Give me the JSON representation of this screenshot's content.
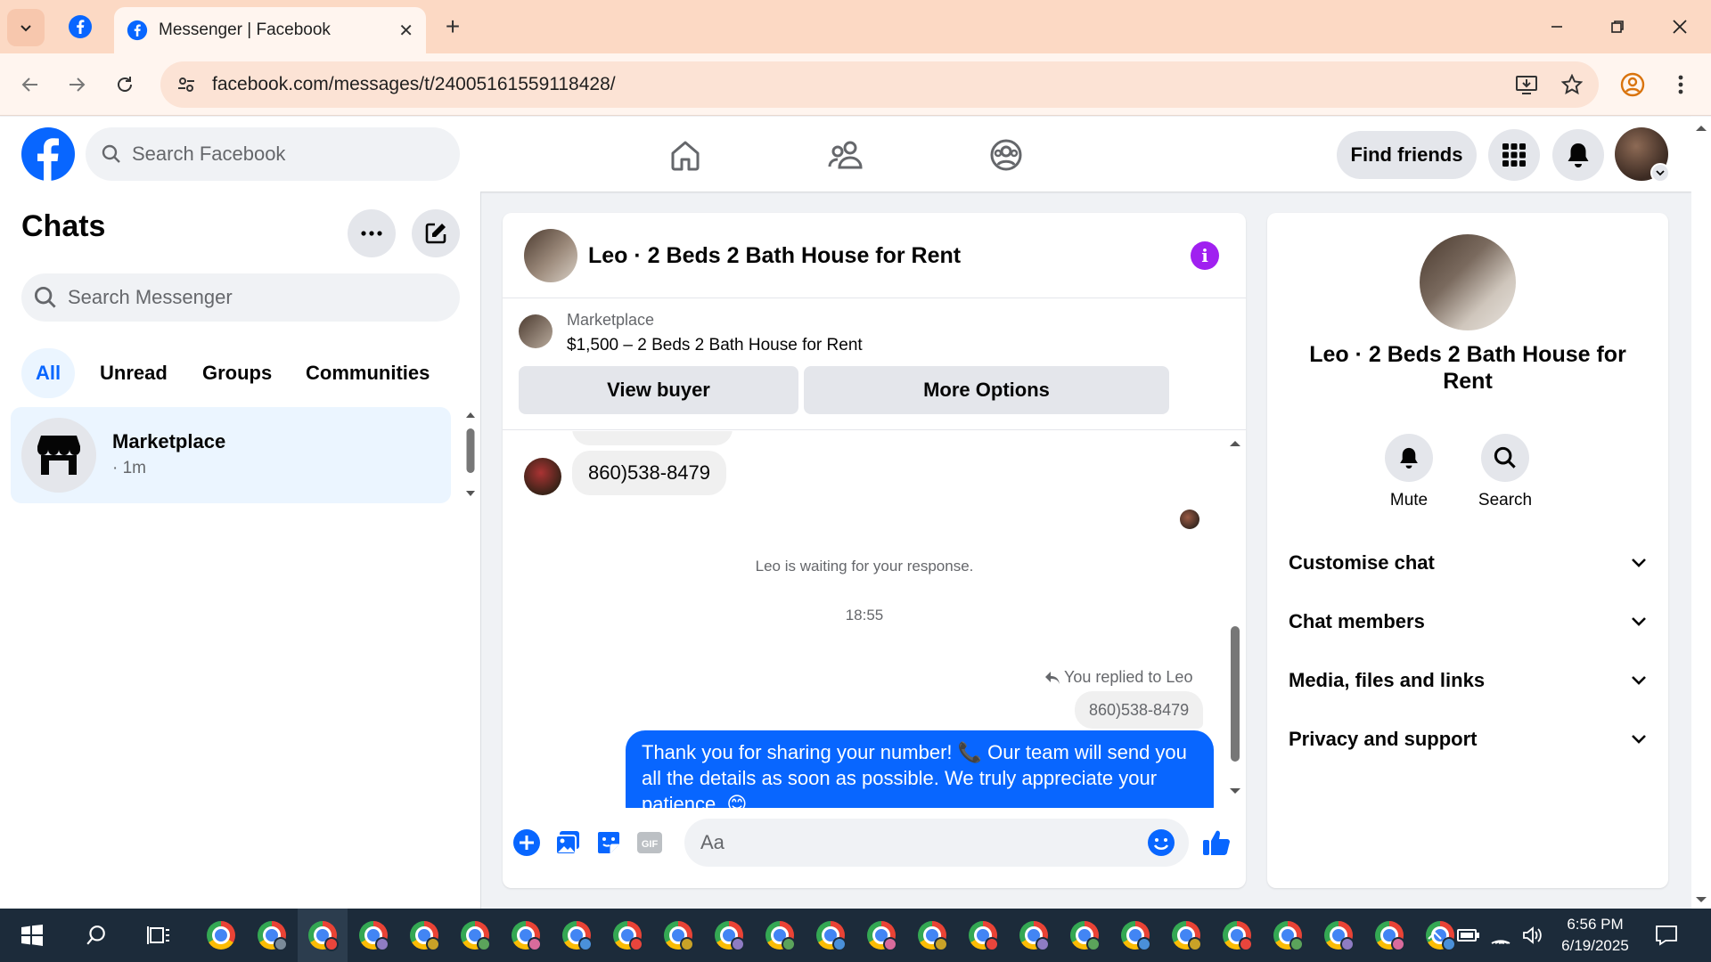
{
  "browser": {
    "tab_title": "Messenger | Facebook",
    "url": "facebook.com/messages/t/24005161559118428/"
  },
  "fb": {
    "search_placeholder": "Search Facebook",
    "find_friends": "Find friends"
  },
  "chats": {
    "title": "Chats",
    "search_placeholder": "Search Messenger",
    "filters": [
      "All",
      "Unread",
      "Groups",
      "Communities"
    ],
    "items": [
      {
        "name": "Marketplace",
        "time": "· 1m"
      }
    ]
  },
  "conversation": {
    "title": "Leo · 2 Beds 2 Bath House for Rent",
    "marketplace": {
      "label": "Marketplace",
      "listing": "$1,500 – 2 Beds 2 Bath House for Rent",
      "view_buyer": "View buyer",
      "more_options": "More Options"
    },
    "messages": {
      "phone_message": "860)538-8479",
      "waiting": "Leo is waiting for your response.",
      "timestamp": "18:55",
      "replied_to": "You replied to Leo",
      "quoted": "860)538-8479",
      "reply_text": "Thank you for sharing your number! 📞 Our team will send you all the details as soon as possible. We truly appreciate your patience. 😊"
    },
    "composer_placeholder": "Aa"
  },
  "details": {
    "name": "Leo · 2 Beds 2 Bath House for Rent",
    "actions": {
      "mute": "Mute",
      "search": "Search"
    },
    "sections": [
      "Customise chat",
      "Chat members",
      "Media, files and links",
      "Privacy and support"
    ]
  },
  "taskbar": {
    "time": "6:56 PM",
    "date": "6/19/2025",
    "chrome_badge_colors": [
      "#7a8a99",
      "#e8453c",
      "#8e7cc3",
      "#c9a227",
      "#5ba35b",
      "#d96b9c",
      "#4a90d9",
      "#e8453c",
      "#c9a227",
      "#8e7cc3",
      "#5ba35b",
      "#4a90d9",
      "#d96b9c",
      "#c9a227",
      "#e8453c",
      "#8e7cc3",
      "#5ba35b",
      "#4a90d9",
      "#c9a227",
      "#e8453c",
      "#5ba35b",
      "#8e7cc3",
      "#d96b9c",
      "#4a90d9"
    ]
  },
  "colors": {
    "accent": "#0866ff",
    "info": "#a020f0"
  }
}
